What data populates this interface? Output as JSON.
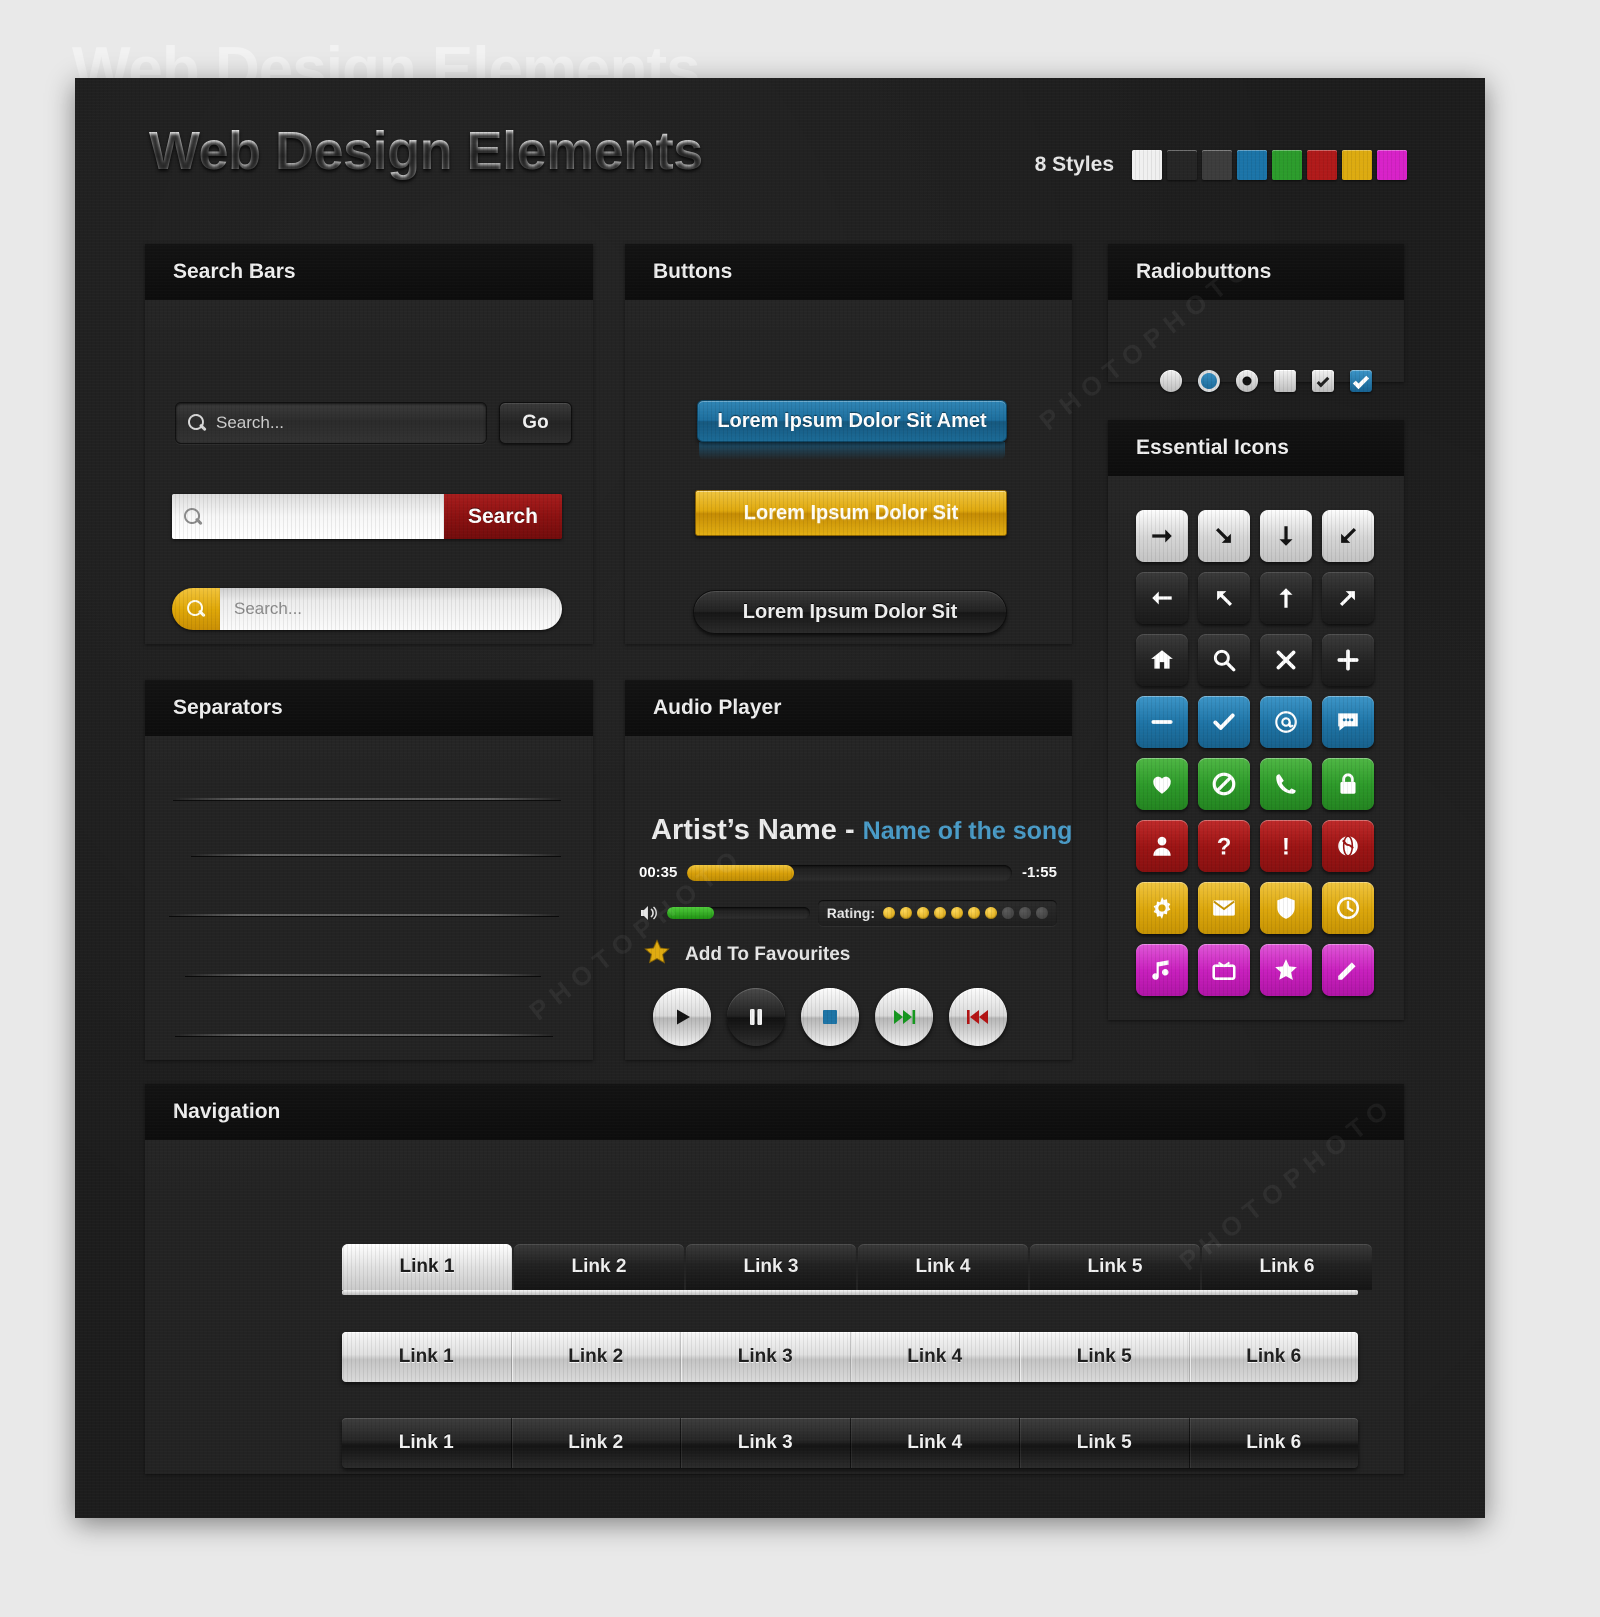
{
  "header": {
    "title": "Web Design Elements",
    "styles_label": "8 Styles",
    "swatches": [
      "#f0f0f0",
      "#262626",
      "#3d3d3d",
      "#1b74a8",
      "#2c9c2c",
      "#b01a1a",
      "#ddab10",
      "#d822c8"
    ]
  },
  "panels": {
    "search_bars": {
      "title": "Search Bars"
    },
    "buttons": {
      "title": "Buttons"
    },
    "radiobuttons": {
      "title": "Radiobuttons"
    },
    "essential_icons": {
      "title": "Essential Icons"
    },
    "separators": {
      "title": "Separators"
    },
    "audio_player": {
      "title": "Audio Player"
    },
    "navigation": {
      "title": "Navigation"
    }
  },
  "search": {
    "dark": {
      "placeholder": "Search...",
      "button_label": "Go",
      "icon": "magnifier-icon"
    },
    "light": {
      "placeholder": "",
      "button_label": "Search",
      "icon": "magnifier-icon"
    },
    "rounded": {
      "placeholder": "Search...",
      "icon": "magnifier-icon"
    }
  },
  "buttons": {
    "blue_label": "Lorem Ipsum Dolor Sit Amet",
    "gold_label": "Lorem Ipsum Dolor Sit",
    "dark_label": "Lorem Ipsum Dolor Sit"
  },
  "radiobuttons": [
    {
      "name": "radio-unselected-light",
      "type": "circle",
      "style": "light",
      "state": "off"
    },
    {
      "name": "radio-selected-blue",
      "type": "circle",
      "style": "blue",
      "state": "on"
    },
    {
      "name": "radio-selected-light",
      "type": "circle",
      "style": "light",
      "state": "dot"
    },
    {
      "name": "checkbox-unchecked-light",
      "type": "square",
      "style": "light",
      "state": "off"
    },
    {
      "name": "checkbox-checked-light",
      "type": "square",
      "style": "light",
      "state": "check"
    },
    {
      "name": "checkbox-checked-blue",
      "type": "square",
      "style": "blue",
      "state": "check"
    }
  ],
  "icons": [
    {
      "name": "arrow-right-icon",
      "color": "light"
    },
    {
      "name": "arrow-down-right-icon",
      "color": "light"
    },
    {
      "name": "arrow-down-icon",
      "color": "light"
    },
    {
      "name": "arrow-down-left-icon",
      "color": "light"
    },
    {
      "name": "arrow-left-icon",
      "color": "dark"
    },
    {
      "name": "arrow-up-left-icon",
      "color": "dark"
    },
    {
      "name": "arrow-up-icon",
      "color": "dark"
    },
    {
      "name": "arrow-up-right-icon",
      "color": "dark"
    },
    {
      "name": "home-icon",
      "color": "dark"
    },
    {
      "name": "search-icon",
      "color": "dark"
    },
    {
      "name": "close-icon",
      "color": "dark"
    },
    {
      "name": "plus-icon",
      "color": "dark"
    },
    {
      "name": "minus-icon",
      "color": "blue"
    },
    {
      "name": "check-icon",
      "color": "blue"
    },
    {
      "name": "at-icon",
      "color": "blue"
    },
    {
      "name": "chat-bubble-icon",
      "color": "blue"
    },
    {
      "name": "heart-icon",
      "color": "green"
    },
    {
      "name": "forbidden-icon",
      "color": "green"
    },
    {
      "name": "phone-icon",
      "color": "green"
    },
    {
      "name": "lock-icon",
      "color": "green"
    },
    {
      "name": "user-icon",
      "color": "red"
    },
    {
      "name": "question-mark-icon",
      "color": "red"
    },
    {
      "name": "exclamation-mark-icon",
      "color": "red"
    },
    {
      "name": "globe-icon",
      "color": "red"
    },
    {
      "name": "gear-icon",
      "color": "gold"
    },
    {
      "name": "envelope-icon",
      "color": "gold"
    },
    {
      "name": "shield-icon",
      "color": "gold"
    },
    {
      "name": "clock-icon",
      "color": "gold"
    },
    {
      "name": "music-note-icon",
      "color": "magenta"
    },
    {
      "name": "television-icon",
      "color": "magenta"
    },
    {
      "name": "star-icon",
      "color": "magenta"
    },
    {
      "name": "pencil-icon",
      "color": "magenta"
    }
  ],
  "separators": {
    "count": 5
  },
  "audio": {
    "artist": "Artist’s Name",
    "dash": " - ",
    "song": "Name of the song",
    "elapsed": "00:35",
    "remaining": "-1:55",
    "progress_percent": 33,
    "volume_percent": 33,
    "rating_label": "Rating:",
    "rating_filled": 7,
    "rating_total": 10,
    "favourites_label": "Add To Favourites",
    "controls": [
      {
        "name": "play-button",
        "glyph": "play",
        "style": "light"
      },
      {
        "name": "pause-button",
        "glyph": "pause",
        "style": "dark"
      },
      {
        "name": "stop-button",
        "glyph": "stop",
        "style": "light"
      },
      {
        "name": "next-button",
        "glyph": "next",
        "style": "light"
      },
      {
        "name": "previous-button",
        "glyph": "prev",
        "style": "light"
      }
    ]
  },
  "navigation": {
    "tabs": [
      "Link 1",
      "Link 2",
      "Link 3",
      "Link 4",
      "Link 5",
      "Link 6"
    ],
    "active_index": 0,
    "bar_light": [
      "Link 1",
      "Link 2",
      "Link 3",
      "Link 4",
      "Link 5",
      "Link 6"
    ],
    "bar_dark": [
      "Link 1",
      "Link 2",
      "Link 3",
      "Link 4",
      "Link 5",
      "Link 6"
    ]
  }
}
